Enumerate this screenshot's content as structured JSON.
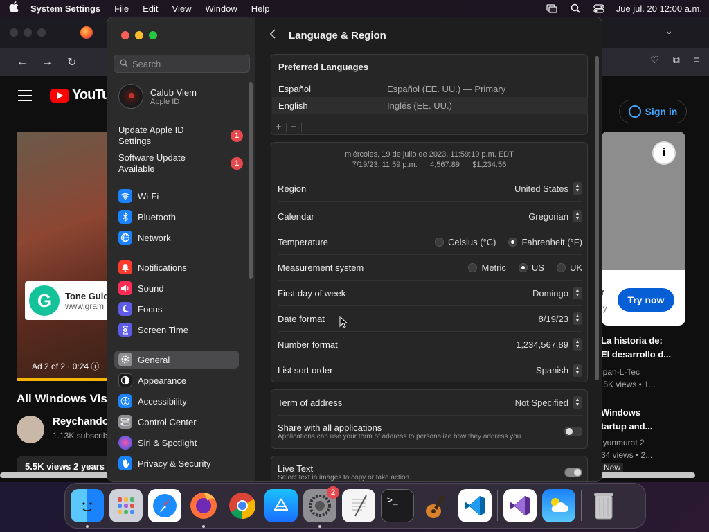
{
  "menubar": {
    "app_name": "System Settings",
    "menus": [
      "File",
      "Edit",
      "View",
      "Window",
      "Help"
    ],
    "clock": "Jue jul. 20  12:00 a.m."
  },
  "browser": {
    "youtube": {
      "logo_text": "YouTub",
      "ad_title": "Tone Guid",
      "ad_url": "www.gram",
      "ad_label": "Ad 2 of 2 · 0:24  ⓘ",
      "video_title": "All Windows Vis",
      "channel": "Reychando",
      "subscribers": "1.13K subscrib",
      "views": "5.5K views  2 years",
      "sign_in": "Sign in",
      "try_now": "Try now",
      "side_card_fragment_1": "r",
      "side_card_fragment_2": "ly",
      "side_video_1_title": "La historia de:\n El desarrollo d...",
      "side_video_1_channel": "lpan-L-Tec",
      "side_video_1_meta": ".5K views  • 1...",
      "side_video_2_title": "Windows\n tartup and...",
      "side_video_2_channel": "lyunmurat 2",
      "side_video_2_meta": "34 views  • 2...",
      "side_video_2_badge": "New"
    }
  },
  "settings": {
    "search_placeholder": "Search",
    "profile": {
      "name": "Calub Viem",
      "sub": "Apple ID"
    },
    "updates": [
      {
        "label": "Update Apple ID Settings",
        "badge": "1"
      },
      {
        "label": "Software Update Available",
        "badge": "1"
      }
    ],
    "sidebar_group_1": [
      {
        "label": "Wi-Fi",
        "icon": "wifi-icon",
        "color": "#1a82fb"
      },
      {
        "label": "Bluetooth",
        "icon": "bluetooth-icon",
        "color": "#1a82fb"
      },
      {
        "label": "Network",
        "icon": "globe-icon",
        "color": "#1a82fb"
      }
    ],
    "sidebar_group_2": [
      {
        "label": "Notifications",
        "icon": "bell-icon",
        "color": "#ff3b30"
      },
      {
        "label": "Sound",
        "icon": "speaker-icon",
        "color": "#ff2d55"
      },
      {
        "label": "Focus",
        "icon": "moon-icon",
        "color": "#5e5ce6"
      },
      {
        "label": "Screen Time",
        "icon": "hourglass-icon",
        "color": "#5e5ce6"
      }
    ],
    "sidebar_group_3": [
      {
        "label": "General",
        "icon": "gear-icon",
        "color": "#8e8e93"
      },
      {
        "label": "Appearance",
        "icon": "appearance-icon",
        "color": "#1c1c1e"
      },
      {
        "label": "Accessibility",
        "icon": "accessibility-icon",
        "color": "#1a82fb"
      },
      {
        "label": "Control Center",
        "icon": "control-center-icon",
        "color": "#8e8e93"
      },
      {
        "label": "Siri & Spotlight",
        "icon": "siri-icon",
        "color": "#c644fc"
      },
      {
        "label": "Privacy & Security",
        "icon": "hand-icon",
        "color": "#1a82fb"
      }
    ],
    "page_title": "Language & Region",
    "preferred_languages": {
      "title": "Preferred Languages",
      "rows": [
        {
          "name": "Español",
          "detail": "Español (EE. UU.) — Primary"
        },
        {
          "name": "English",
          "detail": "Inglés (EE. UU.)"
        }
      ],
      "add": "+",
      "remove": "−"
    },
    "preview_line_1": "miércoles, 19 de julio de 2023, 11:59:19 p.m. EDT",
    "preview_line_2": "7/19/23, 11:59 p.m.      4,567.89      $1,234.56",
    "region": {
      "label": "Region",
      "value": "United States"
    },
    "calendar": {
      "label": "Calendar",
      "value": "Gregorian"
    },
    "temperature": {
      "label": "Temperature",
      "options": [
        "Celsius (°C)",
        "Fahrenheit (°F)"
      ],
      "selected": "Fahrenheit (°F)"
    },
    "measurement": {
      "label": "Measurement system",
      "options": [
        "Metric",
        "US",
        "UK"
      ],
      "selected": "US"
    },
    "first_day": {
      "label": "First day of week",
      "value": "Domingo"
    },
    "date_format": {
      "label": "Date format",
      "value": "8/19/23"
    },
    "number_format": {
      "label": "Number format",
      "value": "1,234,567.89"
    },
    "list_sort": {
      "label": "List sort order",
      "value": "Spanish"
    },
    "term_of_address": {
      "label": "Term of address",
      "value": "Not Specified"
    },
    "share_apps": {
      "label": "Share with all applications",
      "sub": "Applications can use your term of address to personalize how they address you.",
      "enabled": false
    },
    "live_text": {
      "label": "Live Text",
      "sub": "Select text in images to copy or take action.",
      "enabled": true
    }
  },
  "dock": {
    "apps": [
      {
        "name": "finder",
        "running": true
      },
      {
        "name": "launchpad",
        "running": false
      },
      {
        "name": "safari",
        "running": false
      },
      {
        "name": "firefox",
        "running": true
      },
      {
        "name": "chrome",
        "running": false
      },
      {
        "name": "app-store",
        "running": false
      },
      {
        "name": "system-settings",
        "running": true,
        "badge": "2"
      },
      {
        "name": "textedit",
        "running": false
      },
      {
        "name": "terminal",
        "running": false
      },
      {
        "name": "garageband",
        "running": false
      },
      {
        "name": "vscode",
        "running": false
      },
      {
        "name": "visual-studio",
        "running": false
      },
      {
        "name": "weather",
        "running": false
      },
      {
        "name": "trash",
        "running": false
      }
    ]
  }
}
